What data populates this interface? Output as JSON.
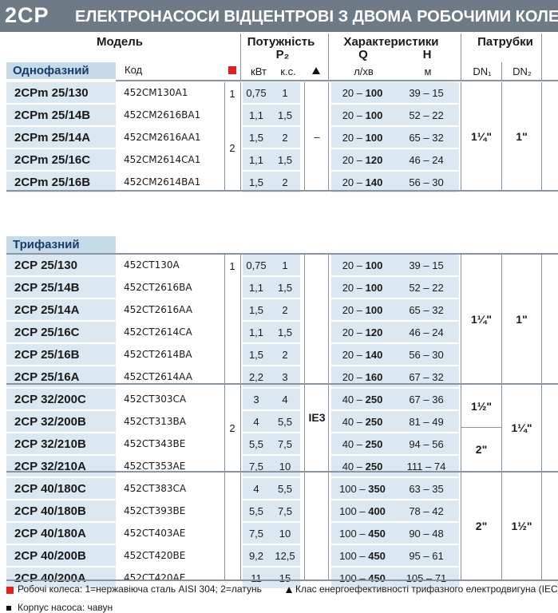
{
  "title": {
    "model": "2CP",
    "text": "ЕЛЕКТРОНАСОСИ ВІДЦЕНТРОВІ З ДВОМА РОБОЧИМИ КОЛЕСА"
  },
  "header": {
    "model": "Модель",
    "power": "Потужність",
    "p2": "P₂",
    "characteristics": "Характеристики",
    "q": "Q",
    "h": "H",
    "ports": "Патрубки",
    "code": "Код",
    "kw": "кВт",
    "hp": "к.с.",
    "q_unit": "л/хв",
    "h_unit": "м",
    "dn1": "DN₁",
    "dn2": "DN₂",
    "impeller_icon": "red-square-icon",
    "efficiency_icon": "up-triangle-icon"
  },
  "single_phase": {
    "label": "Однофазний",
    "rows": [
      {
        "model": "2CPm 25/130",
        "code": "452CM130A1",
        "kw": "0,75",
        "hp": "1",
        "q": "20 – ",
        "qmax": "100",
        "h": "39 – 15"
      },
      {
        "model": "2CPm 25/14B",
        "code": "452CM2616BA1",
        "kw": "1,1",
        "hp": "1,5",
        "q": "20 – ",
        "qmax": "100",
        "h": "52 – 22"
      },
      {
        "model": "2CPm 25/14A",
        "code": "452CM2616AA1",
        "kw": "1,5",
        "hp": "2",
        "q": "20 – ",
        "qmax": "100",
        "h": "65 – 32"
      },
      {
        "model": "2CPm 25/16C",
        "code": "452CM2614CA1",
        "kw": "1,1",
        "hp": "1,5",
        "q": "20 – ",
        "qmax": "120",
        "h": "46 – 24"
      },
      {
        "model": "2CPm 25/16B",
        "code": "452CM2614BA1",
        "kw": "1,5",
        "hp": "2",
        "q": "20 – ",
        "qmax": "140",
        "h": "56 – 30"
      }
    ],
    "impeller_1": "1",
    "impeller_2": "2",
    "efficiency": "–",
    "dn1": "1¼\"",
    "dn2": "1\""
  },
  "three_phase": {
    "label": "Трифазний",
    "rows": [
      {
        "model": "2CP 25/130",
        "code": "452CT130A",
        "kw": "0,75",
        "hp": "1",
        "q": "20 – ",
        "qmax": "100",
        "h": "39 – 15"
      },
      {
        "model": "2CP 25/14B",
        "code": "452CT2616BA",
        "kw": "1,1",
        "hp": "1,5",
        "q": "20 – ",
        "qmax": "100",
        "h": "52 – 22"
      },
      {
        "model": "2CP 25/14A",
        "code": "452CT2616AA",
        "kw": "1,5",
        "hp": "2",
        "q": "20 – ",
        "qmax": "100",
        "h": "65 – 32"
      },
      {
        "model": "2CP 25/16C",
        "code": "452CT2614CA",
        "kw": "1,1",
        "hp": "1,5",
        "q": "20 – ",
        "qmax": "120",
        "h": "46 – 24"
      },
      {
        "model": "2CP 25/16B",
        "code": "452CT2614BA",
        "kw": "1,5",
        "hp": "2",
        "q": "20 – ",
        "qmax": "140",
        "h": "56 – 30"
      },
      {
        "model": "2CP 25/16A",
        "code": "452CT2614AA",
        "kw": "2,2",
        "hp": "3",
        "q": "20 – ",
        "qmax": "160",
        "h": "67 – 32"
      },
      {
        "model": "2CP 32/200C",
        "code": "452CT303CA",
        "kw": "3",
        "hp": "4",
        "q": "40 – ",
        "qmax": "250",
        "h": "67 – 36"
      },
      {
        "model": "2CP 32/200B",
        "code": "452CT313BA",
        "kw": "4",
        "hp": "5,5",
        "q": "40 – ",
        "qmax": "250",
        "h": "81 – 49"
      },
      {
        "model": "2CP 32/210B",
        "code": "452CT343BE",
        "kw": "5,5",
        "hp": "7,5",
        "q": "40 – ",
        "qmax": "250",
        "h": "94 – 56"
      },
      {
        "model": "2CP 32/210A",
        "code": "452CT353AE",
        "kw": "7,5",
        "hp": "10",
        "q": "40 – ",
        "qmax": "250",
        "h": "111 – 74"
      },
      {
        "model": "2CP 40/180C",
        "code": "452CT383CA",
        "kw": "4",
        "hp": "5,5",
        "q": "100 – ",
        "qmax": "350",
        "h": "63 – 35"
      },
      {
        "model": "2CP 40/180B",
        "code": "452CT393BE",
        "kw": "5,5",
        "hp": "7,5",
        "q": "100 – ",
        "qmax": "400",
        "h": "78 – 42"
      },
      {
        "model": "2CP 40/180A",
        "code": "452CT403AE",
        "kw": "7,5",
        "hp": "10",
        "q": "100 – ",
        "qmax": "450",
        "h": "90 – 48"
      },
      {
        "model": "2CP 40/200B",
        "code": "452CT420BE",
        "kw": "9,2",
        "hp": "12,5",
        "q": "100 – ",
        "qmax": "450",
        "h": "95 – 61"
      },
      {
        "model": "2CP 40/200A",
        "code": "452CT420AE",
        "kw": "11",
        "hp": "15",
        "q": "100 – ",
        "qmax": "450",
        "h": "105 – 71"
      }
    ],
    "impeller_1": "1",
    "impeller_2": "2",
    "efficiency": "IE3",
    "dn1_a": "1¼\"",
    "dn2_a": "1\"",
    "dn1_b": "1½\"",
    "dn1_c": "2\"",
    "dn2_b": "1¼\"",
    "dn1_d": "2\"",
    "dn2_d": "1½\""
  },
  "footer": {
    "impeller_note": "Робочі колеса: 1=нержавіюча сталь AISI 304; 2=латунь",
    "efficiency_note": "Клас енергоефективності трифазного електродвигуна (IEC",
    "body_note": "Корпус насоса: чавун"
  }
}
